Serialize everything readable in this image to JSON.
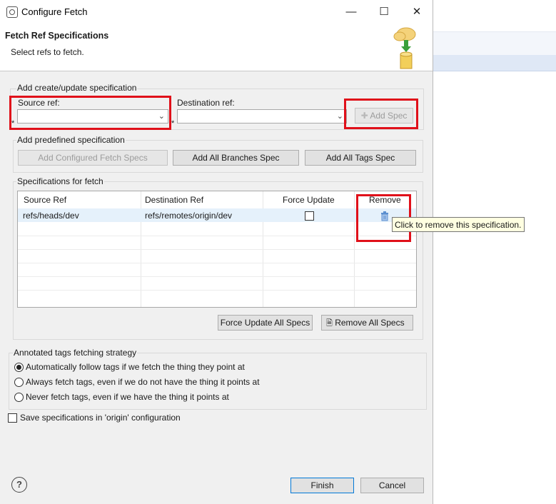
{
  "window": {
    "title": "Configure Fetch",
    "min": "—",
    "max": "☐",
    "close": "✕"
  },
  "header": {
    "title": "Fetch Ref Specifications",
    "subtitle": "Select refs to fetch."
  },
  "create_group": {
    "label": "Add create/update specification",
    "source_label": "Source ref:",
    "dest_label": "Destination ref:",
    "source_value": "",
    "dest_value": "",
    "required_mark": "*",
    "add_spec": "Add Spec"
  },
  "predefined_group": {
    "label": "Add predefined specification",
    "add_configured": "Add Configured Fetch Specs",
    "add_branches": "Add All Branches Spec",
    "add_tags": "Add All Tags Spec"
  },
  "specs_group": {
    "label": "Specifications for fetch",
    "columns": [
      "Source Ref",
      "Destination Ref",
      "Force Update",
      "Remove"
    ],
    "rows": [
      {
        "source": "refs/heads/dev",
        "destination": "refs/remotes/origin/dev",
        "force": false
      }
    ],
    "tooltip": "Click to remove this specification.",
    "force_all": "Force Update All Specs",
    "remove_all": "Remove All Specs"
  },
  "tags_group": {
    "label": "Annotated tags fetching strategy",
    "options": [
      "Automatically follow tags if we fetch the thing they point at",
      "Always fetch tags, even if we do not have the thing it points at",
      "Never fetch tags, even if we have the thing it points at"
    ],
    "selected": 0
  },
  "save_config": "Save specifications in 'origin' configuration",
  "footer": {
    "help": "?",
    "finish": "Finish",
    "cancel": "Cancel"
  }
}
